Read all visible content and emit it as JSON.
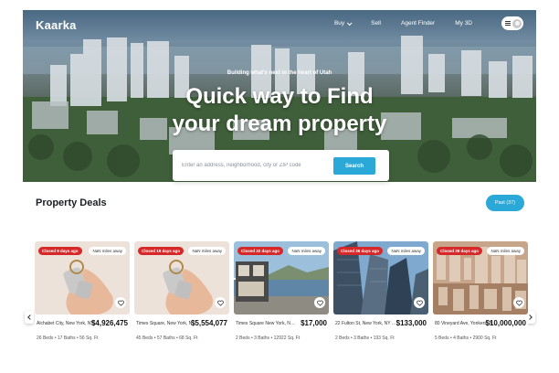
{
  "header": {
    "logo": "Kaarka",
    "nav": [
      {
        "label": "Buy",
        "dropdown": true
      },
      {
        "label": "Sell",
        "dropdown": false
      },
      {
        "label": "Agent Finder",
        "dropdown": false
      },
      {
        "label": "My 3D",
        "dropdown": false
      }
    ],
    "menu_icon": "hamburger-icon",
    "avatar_icon": "user-avatar-icon"
  },
  "hero": {
    "tagline": "Building what's next in the heart of Utah",
    "headline_line1": "Quick way to Find",
    "headline_line2": "your dream property"
  },
  "search": {
    "placeholder": "Enter an address, neighborhood, city or ZIP code",
    "button_label": "Search"
  },
  "deals": {
    "title": "Property Deals",
    "past_button": "Past (37)",
    "cards": [
      {
        "badge": "Closed 9 days ago",
        "distance": "NaN miles away",
        "address": "Alchabet City, New York, NY 1...",
        "price": "$4,926,475",
        "specs": "26 Beds  •  17 Baths  •  56 Sq. Ft",
        "image": "keys-hand"
      },
      {
        "badge": "Closed 19 days ago",
        "distance": "NaN miles away",
        "address": "Times Square, New York, NY 1...",
        "price": "$5,554,077",
        "specs": "45 Beds  •  57 Baths  •  68 Sq. Ft",
        "image": "keys-hand"
      },
      {
        "badge": "Closed 32 days ago",
        "distance": "NaN miles away",
        "address": "Times Square New York, NY 10036...",
        "price": "$17,000",
        "specs": "2 Beds  •  3 Baths  •  12922 Sq. Ft",
        "image": "lake-house"
      },
      {
        "badge": "Closed 36 days ago",
        "distance": "NaN miles away",
        "address": "22 Fulton St, New York, NY 1003...",
        "price": "$133,000",
        "specs": "2 Beds  •  3 Baths  •  193 Sq. Ft",
        "image": "skyscrapers"
      },
      {
        "badge": "Closed 39 days ago",
        "distance": "NaN miles away",
        "address": "80 Vineyard Ave, Yonkers, N...",
        "price": "$10,000,000",
        "specs": "5 Beds  •  4 Baths  •  2900 Sq. Ft",
        "image": "city-aerial"
      }
    ]
  },
  "colors": {
    "accent": "#2aa8d8",
    "badge_red": "#d62828"
  }
}
